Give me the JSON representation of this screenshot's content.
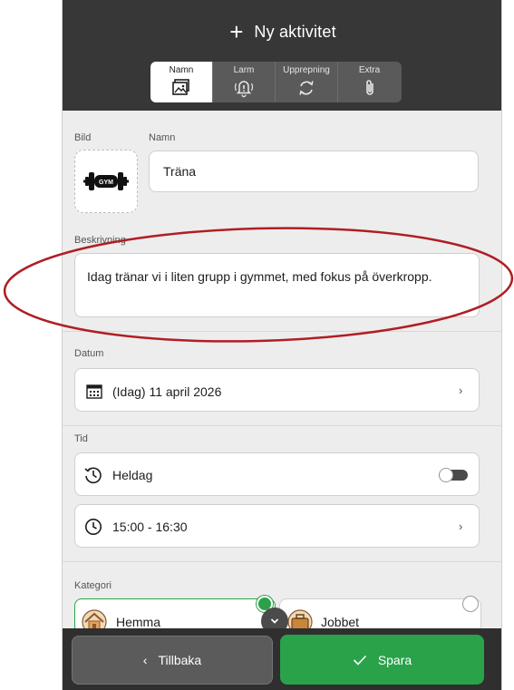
{
  "header": {
    "title": "Ny aktivitet",
    "tabs": [
      {
        "label": "Namn",
        "icon": "image-icon",
        "active": true
      },
      {
        "label": "Larm",
        "icon": "alarm-bell-icon",
        "active": false
      },
      {
        "label": "Upprepning",
        "icon": "repeat-icon",
        "active": false
      },
      {
        "label": "Extra",
        "icon": "paperclip-icon",
        "active": false
      }
    ]
  },
  "form": {
    "image_label": "Bild",
    "name_label": "Namn",
    "name_value": "Träna",
    "gym_badge": "GYM",
    "description_label": "Beskrivning",
    "description_value": "Idag tränar vi i liten grupp i gymmet, med fokus på överkropp.",
    "date_label": "Datum",
    "date_value": "(Idag) 11 april 2026",
    "time_label": "Tid",
    "all_day_label": "Heldag",
    "all_day_on": false,
    "time_value": "15:00 - 16:30",
    "category_label": "Kategori",
    "categories": [
      {
        "label": "Hemma",
        "selected": true
      },
      {
        "label": "Jobbet",
        "selected": false
      }
    ]
  },
  "footer": {
    "back_label": "Tillbaka",
    "save_label": "Spara"
  },
  "colors": {
    "header_bg": "#373737",
    "accent_green": "#2aa24a",
    "annotation_red": "#b01e23"
  }
}
